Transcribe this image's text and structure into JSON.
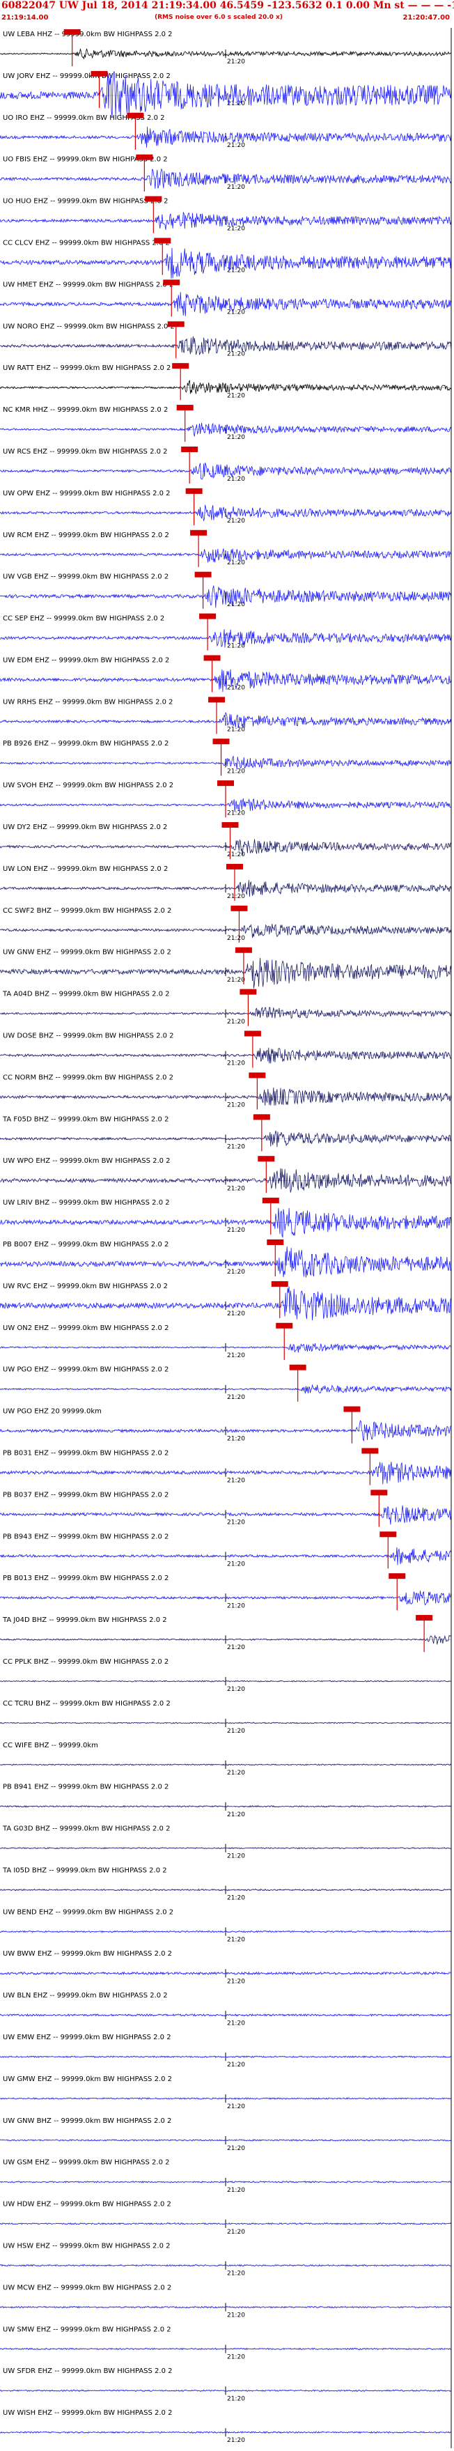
{
  "header": {
    "title": "60822047 UW Jul 18, 2014 21:19:34.00  46.5459 -123.5632  0.1 0.00 Mn st — — — -1",
    "start_time": "21:19:14.00",
    "rms_note": "(RMS noise over 6.0 s scaled 20.0 x)",
    "end_time": "21:20:47.00"
  },
  "chart_data": {
    "type": "seismogram-record-section",
    "minute_marker": "21:20",
    "time_window": [
      "21:19:14.00",
      "21:20:47.00"
    ],
    "colors": {
      "blue": "#1a1aff",
      "navy": "#1a1a66",
      "black": "#000000",
      "pick": "#d40000",
      "label": "#000000"
    },
    "traces": [
      {
        "label": "UW LEBA HHZ -- 99999.0km BW  HIGHPASS  2.0  2",
        "color": "black",
        "amp": 6,
        "pick": 0.16
      },
      {
        "label": "UW JORV EHZ -- 99999.0km BW  HIGHPASS  2.0  2",
        "color": "blue",
        "amp": 30,
        "pick": 0.22
      },
      {
        "label": "UO IRO EHZ -- 99999.0km BW  HIGHPASS  2.0  2",
        "color": "blue",
        "amp": 12,
        "pick": 0.3
      },
      {
        "label": "UO FBIS EHZ -- 99999.0km BW  HIGHPASS  2.0  2",
        "color": "blue",
        "amp": 12,
        "pick": 0.32
      },
      {
        "label": "UO HUO EHZ -- 99999.0km BW  HIGHPASS  2.0  2",
        "color": "blue",
        "amp": 12,
        "pick": 0.34
      },
      {
        "label": "CC CLCV EHZ -- 99999.0km BW  HIGHPASS  2.0  2",
        "color": "blue",
        "amp": 18,
        "pick": 0.36
      },
      {
        "label": "UW HMET EHZ -- 99999.0km BW  HIGHPASS  2.0  2",
        "color": "blue",
        "amp": 14,
        "pick": 0.38
      },
      {
        "label": "UW NORO EHZ -- 99999.0km BW  HIGHPASS  2.0  2",
        "color": "navy",
        "amp": 12,
        "pick": 0.39
      },
      {
        "label": "UW RATT EHZ -- 99999.0km BW  HIGHPASS  2.0  2",
        "color": "black",
        "amp": 8,
        "pick": 0.4
      },
      {
        "label": "NC KMR HHZ -- 99999.0km BW  HIGHPASS  2.0  2",
        "color": "blue",
        "amp": 8,
        "pick": 0.41
      },
      {
        "label": "UW RCS EHZ -- 99999.0km BW  HIGHPASS  2.0  2",
        "color": "blue",
        "amp": 10,
        "pick": 0.42
      },
      {
        "label": "UW OPW EHZ -- 99999.0km BW  HIGHPASS  2.0  2",
        "color": "blue",
        "amp": 10,
        "pick": 0.43
      },
      {
        "label": "UW RCM EHZ -- 99999.0km BW  HIGHPASS  2.0  2",
        "color": "blue",
        "amp": 10,
        "pick": 0.44
      },
      {
        "label": "UW VGB EHZ -- 99999.0km BW  HIGHPASS  2.0  2",
        "color": "blue",
        "amp": 14,
        "pick": 0.45
      },
      {
        "label": "CC SEP EHZ -- 99999.0km BW  HIGHPASS  2.0  2",
        "color": "blue",
        "amp": 12,
        "pick": 0.46
      },
      {
        "label": "UW EDM EHZ -- 99999.0km BW  HIGHPASS  2.0  2",
        "color": "blue",
        "amp": 14,
        "pick": 0.47
      },
      {
        "label": "UW RRHS EHZ -- 99999.0km BW  HIGHPASS  2.0  2",
        "color": "blue",
        "amp": 10,
        "pick": 0.48
      },
      {
        "label": "PB B926 EHZ -- 99999.0km BW  HIGHPASS  2.0  2",
        "color": "blue",
        "amp": 8,
        "pick": 0.49
      },
      {
        "label": "UW SVOH EHZ -- 99999.0km BW  HIGHPASS  2.0  2",
        "color": "blue",
        "amp": 8,
        "pick": 0.5
      },
      {
        "label": "UW DY2 EHZ -- 99999.0km BW  HIGHPASS  2.0  2",
        "color": "navy",
        "amp": 10,
        "pick": 0.51
      },
      {
        "label": "UW LON EHZ -- 99999.0km BW  HIGHPASS  2.0  2",
        "color": "navy",
        "amp": 10,
        "pick": 0.52
      },
      {
        "label": "CC SWF2 BHZ -- 99999.0km BW  HIGHPASS  2.0  2",
        "color": "navy",
        "amp": 10,
        "pick": 0.53
      },
      {
        "label": "UW GNW EHZ -- 99999.0km BW  HIGHPASS  2.0  2",
        "color": "navy",
        "amp": 20,
        "pick": 0.54
      },
      {
        "label": "TA A04D BHZ -- 99999.0km BW  HIGHPASS  2.0  2",
        "color": "navy",
        "amp": 8,
        "pick": 0.55
      },
      {
        "label": "UW DOSE BHZ -- 99999.0km BW  HIGHPASS  2.0  2",
        "color": "navy",
        "amp": 10,
        "pick": 0.56
      },
      {
        "label": "CC NORM BHZ -- 99999.0km BW  HIGHPASS  2.0  2",
        "color": "navy",
        "amp": 12,
        "pick": 0.57
      },
      {
        "label": "TA F05D BHZ -- 99999.0km BW  HIGHPASS  2.0  2",
        "color": "navy",
        "amp": 10,
        "pick": 0.58
      },
      {
        "label": "UW WPO EHZ -- 99999.0km BW  HIGHPASS  2.0  2",
        "color": "navy",
        "amp": 16,
        "pick": 0.59
      },
      {
        "label": "UW LRIV BHZ -- 99999.0km BW  HIGHPASS  2.0  2",
        "color": "blue",
        "amp": 18,
        "pick": 0.6
      },
      {
        "label": "PB B007 EHZ -- 99999.0km BW  HIGHPASS  2.0  2",
        "color": "blue",
        "amp": 20,
        "pick": 0.61
      },
      {
        "label": "UW RVC EHZ -- 99999.0km BW  HIGHPASS  2.0  2",
        "color": "blue",
        "amp": 22,
        "pick": 0.62
      },
      {
        "label": "UW ON2 EHZ -- 99999.0km BW  HIGHPASS  2.0  2",
        "color": "blue",
        "amp": 6,
        "pick": 0.63
      },
      {
        "label": "UW PGO EHZ -- 99999.0km BW  HIGHPASS  2.0  2",
        "color": "blue",
        "amp": 6,
        "pick": 0.66
      },
      {
        "label": "UW PGO EHZ 20 99999.0km",
        "color": "blue",
        "amp": 12,
        "pick": 0.78
      },
      {
        "label": "PB B031 EHZ -- 99999.0km BW  HIGHPASS  2.0  2",
        "color": "blue",
        "amp": 14,
        "pick": 0.82
      },
      {
        "label": "PB B037 EHZ -- 99999.0km BW  HIGHPASS  2.0  2",
        "color": "blue",
        "amp": 12,
        "pick": 0.84
      },
      {
        "label": "PB B943 EHZ -- 99999.0km BW  HIGHPASS  2.0  2",
        "color": "blue",
        "amp": 10,
        "pick": 0.86
      },
      {
        "label": "PB B013 EHZ -- 99999.0km BW  HIGHPASS  2.0  2",
        "color": "blue",
        "amp": 10,
        "pick": 0.88
      },
      {
        "label": "TA J04D BHZ -- 99999.0km BW  HIGHPASS  2.0  2",
        "color": "navy",
        "amp": 6,
        "pick": 0.94
      },
      {
        "label": "CC PPLK BHZ -- 99999.0km BW  HIGHPASS  2.0  2",
        "color": "navy",
        "amp": 5,
        "pick": null
      },
      {
        "label": "CC TCRU BHZ -- 99999.0km BW  HIGHPASS  2.0  2",
        "color": "navy",
        "amp": 5,
        "pick": null
      },
      {
        "label": "CC WIFE BHZ -- 99999.0km",
        "color": "navy",
        "amp": 5,
        "pick": null
      },
      {
        "label": "PB B941 EHZ -- 99999.0km BW  HIGHPASS  2.0  2",
        "color": "navy",
        "amp": 6,
        "pick": null
      },
      {
        "label": "TA G03D BHZ -- 99999.0km BW  HIGHPASS  2.0  2",
        "color": "navy",
        "amp": 5,
        "pick": null
      },
      {
        "label": "TA I05D BHZ -- 99999.0km BW  HIGHPASS  2.0  2",
        "color": "navy",
        "amp": 6,
        "pick": null
      },
      {
        "label": "UW BEND EHZ -- 99999.0km BW  HIGHPASS  2.0  2",
        "color": "blue",
        "amp": 6,
        "pick": null
      },
      {
        "label": "UW BWW EHZ -- 99999.0km BW  HIGHPASS  2.0  2",
        "color": "blue",
        "amp": 10,
        "pick": null
      },
      {
        "label": "UW BLN EHZ -- 99999.0km BW  HIGHPASS  2.0  2",
        "color": "blue",
        "amp": 8,
        "pick": null
      },
      {
        "label": "UW EMW EHZ -- 99999.0km BW  HIGHPASS  2.0  2",
        "color": "blue",
        "amp": 6,
        "pick": null
      },
      {
        "label": "UW GMW EHZ -- 99999.0km BW  HIGHPASS  2.0  2",
        "color": "blue",
        "amp": 6,
        "pick": null
      },
      {
        "label": "UW GNW BHZ -- 99999.0km BW  HIGHPASS  2.0  2",
        "color": "blue",
        "amp": 6,
        "pick": null
      },
      {
        "label": "UW GSM EHZ -- 99999.0km BW  HIGHPASS  2.0  2",
        "color": "blue",
        "amp": 6,
        "pick": null
      },
      {
        "label": "UW HDW EHZ -- 99999.0km BW  HIGHPASS  2.0  2",
        "color": "blue",
        "amp": 6,
        "pick": null
      },
      {
        "label": "UW HSW EHZ -- 99999.0km BW  HIGHPASS  2.0  2",
        "color": "blue",
        "amp": 6,
        "pick": null
      },
      {
        "label": "UW MCW EHZ -- 99999.0km BW  HIGHPASS  2.0  2",
        "color": "blue",
        "amp": 6,
        "pick": null
      },
      {
        "label": "UW SMW EHZ -- 99999.0km BW  HIGHPASS  2.0  2",
        "color": "blue",
        "amp": 6,
        "pick": null
      },
      {
        "label": "UW SFDR EHZ -- 99999.0km BW  HIGHPASS  2.0  2",
        "color": "blue",
        "amp": 6,
        "pick": null
      },
      {
        "label": "UW WISH EHZ -- 99999.0km BW  HIGHPASS  2.0  2",
        "color": "blue",
        "amp": 6,
        "pick": null
      }
    ]
  }
}
